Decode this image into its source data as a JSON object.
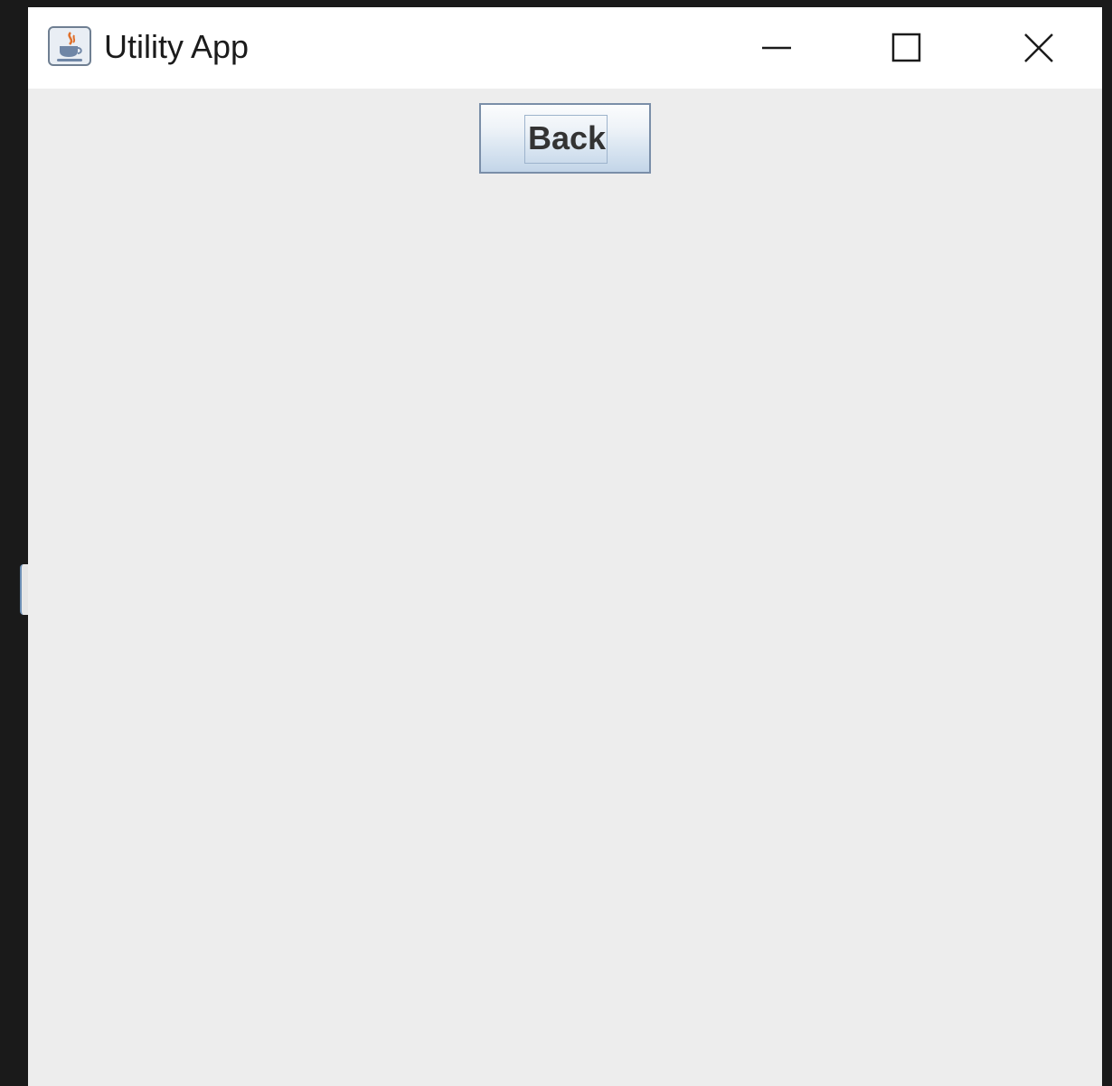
{
  "window": {
    "title": "Utility App",
    "icon": "java-app-icon"
  },
  "controls": {
    "minimize": "minimize-icon",
    "maximize": "maximize-icon",
    "close": "close-icon"
  },
  "content": {
    "back_label": "Back"
  },
  "colors": {
    "titlebar": "#ffffff",
    "content_background": "#ededed",
    "desktop": "#1a1a1a",
    "button_border": "#7a8ea8"
  }
}
